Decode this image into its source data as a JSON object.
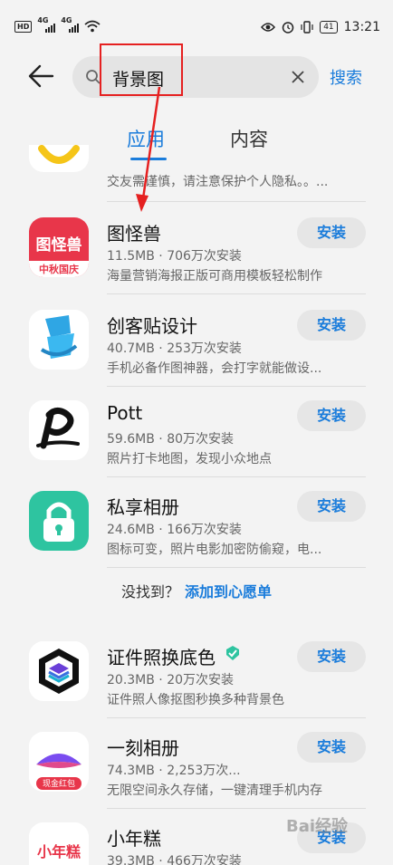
{
  "status_bar": {
    "hd_label": "HD",
    "signal_label_1": "4G",
    "signal_label_2": "4G",
    "battery": "41",
    "time": "13:21"
  },
  "search": {
    "query": "背景图",
    "search_label": "搜索"
  },
  "tabs": [
    {
      "label": "应用",
      "active": true
    },
    {
      "label": "内容",
      "active": false
    }
  ],
  "partial_item": {
    "desc": "交友需谨慎，请注意保护个人隐私。。..."
  },
  "apps": [
    {
      "name": "图怪兽",
      "meta": "11.5MB · 706万次安装",
      "desc": "海量营销海报正版可商用模板轻松制作",
      "install": "安装",
      "icon_text": "图怪兽",
      "icon_sub": "中秋国庆"
    },
    {
      "name": "创客贴设计",
      "meta": "40.7MB · 253万次安装",
      "desc": "手机必备作图神器，会打字就能做设...",
      "install": "安装"
    },
    {
      "name": "Pott",
      "meta": "59.6MB · 80万次安装",
      "desc": "照片打卡地图，发现小众地点",
      "install": "安装"
    },
    {
      "name": "私享相册",
      "meta": "24.6MB · 166万次安装",
      "desc": "图标可变，照片电影加密防偷窥，电...",
      "install": "安装"
    }
  ],
  "not_found": {
    "question": "没找到？",
    "link": "添加到心愿单"
  },
  "apps2": [
    {
      "name": "证件照换底色",
      "meta": "20.3MB · 20万次安装",
      "desc": "证件照人像抠图秒换多种背景色",
      "install": "安装"
    },
    {
      "name": "一刻相册",
      "meta": "74.3MB · 2,253万次...",
      "desc": "无限空间永久存储，一键清理手机内存",
      "install": "安装",
      "icon_sub": "现金红包"
    },
    {
      "name": "小年糕",
      "meta": "39.3MB · 466万次安装",
      "desc": "",
      "install": "安装",
      "icon_text": "小年糕"
    }
  ],
  "watermark": "Bai经验",
  "colors": {
    "accent": "#1a7cdb",
    "highlight": "#e52020"
  }
}
